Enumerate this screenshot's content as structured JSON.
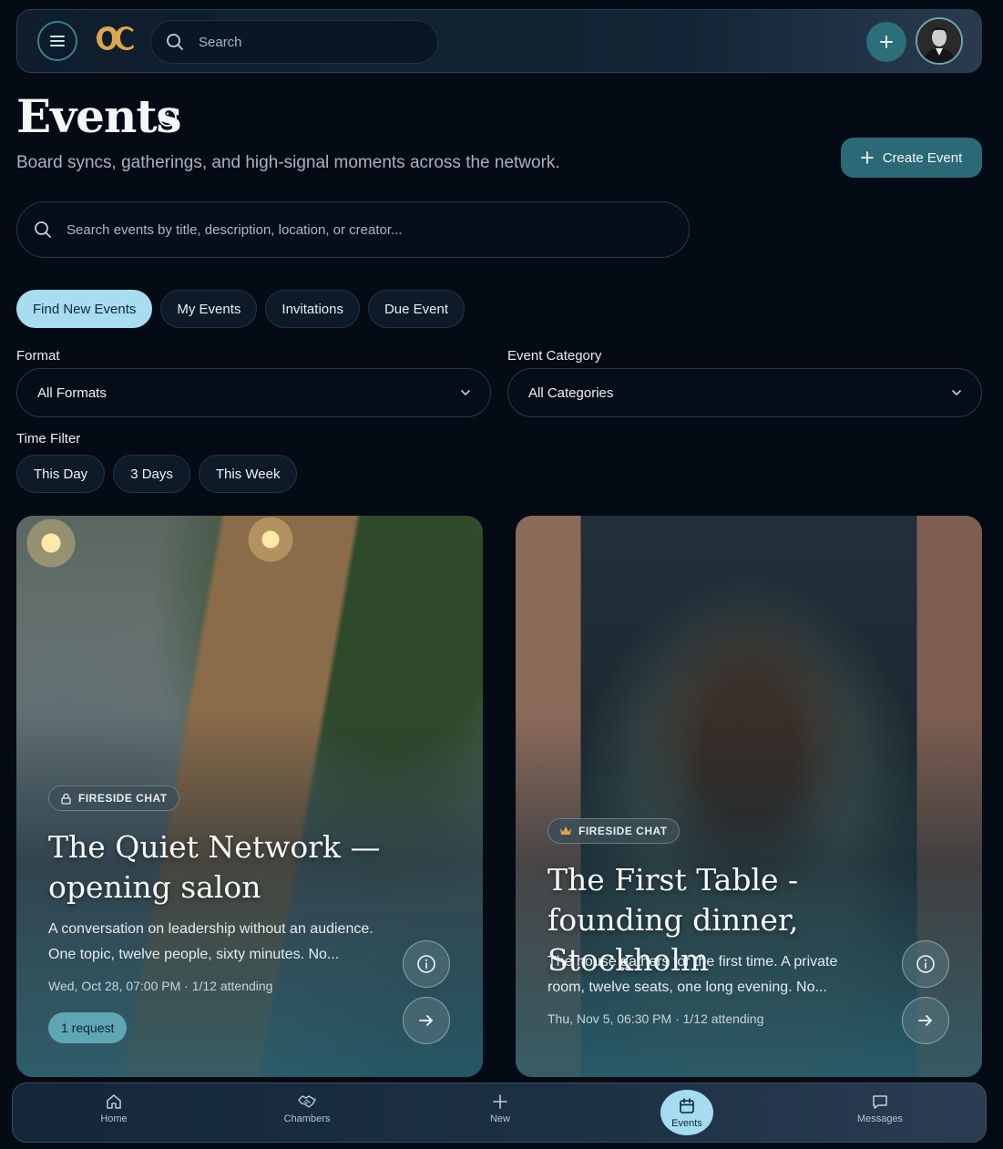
{
  "topbar": {
    "logo_text": "OC",
    "search_placeholder": "Search"
  },
  "header": {
    "title": "Events",
    "subtitle": "Board syncs, gatherings, and high-signal moments across the network.",
    "create_label": "Create Event"
  },
  "event_search": {
    "placeholder": "Search events by title, description, location, or creator..."
  },
  "tabs": [
    {
      "label": "Find New Events",
      "active": true
    },
    {
      "label": "My Events",
      "active": false
    },
    {
      "label": "Invitations",
      "active": false
    },
    {
      "label": "Due Event",
      "active": false
    }
  ],
  "filters": {
    "format_label": "Format",
    "format_value": "All Formats",
    "category_label": "Event Category",
    "category_value": "All Categories",
    "time_label": "Time Filter",
    "time_options": [
      "This Day",
      "3 Days",
      "This Week"
    ]
  },
  "events": [
    {
      "badge": "FIRESIDE CHAT",
      "badge_icon": "lock-icon",
      "title": "The Quiet Network — opening salon",
      "description": "A conversation on leadership without an audience. One topic, twelve people, sixty minutes. No...",
      "meta": "Wed, Oct 28, 07:00 PM · 1/12 attending",
      "request": "1 request"
    },
    {
      "badge": "FIRESIDE CHAT",
      "badge_icon": "crown-icon",
      "title": "The First Table - founding dinner, Stockholm",
      "description": "The house gathers for the first time. A private room, twelve seats, one long evening. No...",
      "meta": "Thu, Nov 5, 06:30 PM · 1/12 attending"
    }
  ],
  "nav": [
    {
      "label": "Home",
      "icon": "home-icon",
      "active": false
    },
    {
      "label": "Chambers",
      "icon": "handshake-icon",
      "active": false
    },
    {
      "label": "New",
      "icon": "plus-icon",
      "active": false
    },
    {
      "label": "Events",
      "icon": "calendar-icon",
      "active": true
    },
    {
      "label": "Messages",
      "icon": "message-icon",
      "active": false
    }
  ],
  "colors": {
    "background": "#050b15",
    "accent": "#2b6976",
    "active_tab": "#a8dcef"
  }
}
